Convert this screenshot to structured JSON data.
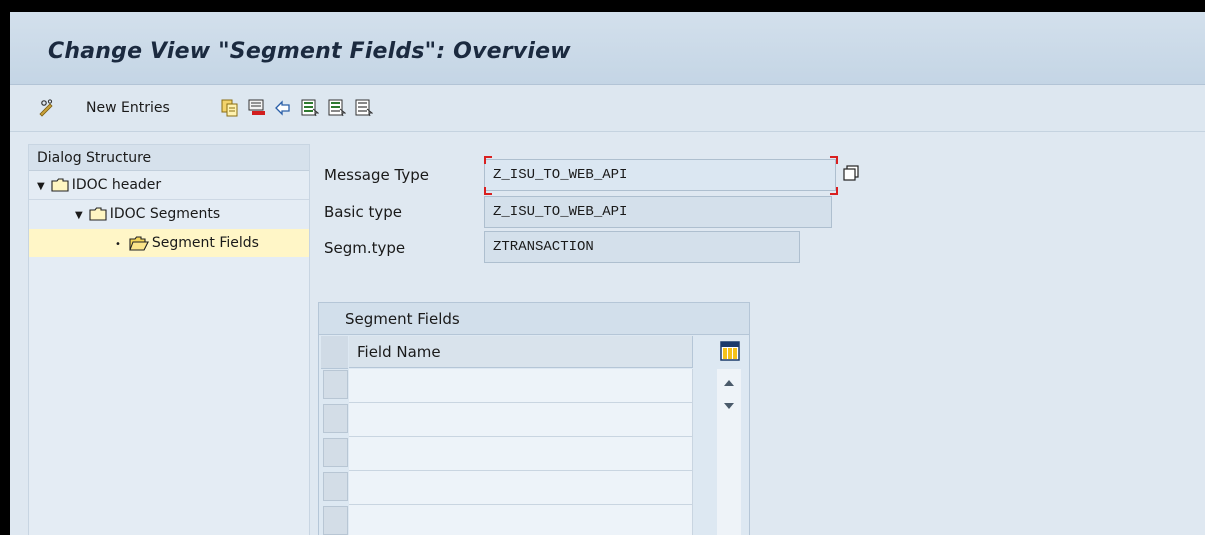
{
  "window": {
    "title": "Change View \"Segment Fields\": Overview"
  },
  "toolbar": {
    "new_entries_label": "New Entries",
    "icons": [
      "edit-toggle-icon",
      "copy-icon",
      "delete-icon",
      "undo-icon",
      "select-all-icon",
      "select-block-icon",
      "deselect-all-icon"
    ]
  },
  "dialog_structure": {
    "header": "Dialog Structure",
    "items": [
      {
        "label": "IDOC header",
        "level": 0,
        "expanded": true
      },
      {
        "label": "IDOC Segments",
        "level": 1,
        "expanded": true
      },
      {
        "label": "Segment Fields",
        "level": 2,
        "selected": true
      }
    ]
  },
  "fields": {
    "message_type_label": "Message Type",
    "message_type_value": "Z_ISU_TO_WEB_API",
    "basic_type_label": "Basic type",
    "basic_type_value": "Z_ISU_TO_WEB_API",
    "segm_type_label": "Segm.type",
    "segm_type_value": "ZTRANSACTION"
  },
  "segment_table": {
    "title": "Segment Fields",
    "columns": [
      "Field Name"
    ],
    "rows": [
      "",
      "",
      "",
      "",
      ""
    ]
  },
  "colors": {
    "title_bg": "#c4d5e5",
    "selected_row": "#fff6c7",
    "focus_marker": "#d92020"
  }
}
